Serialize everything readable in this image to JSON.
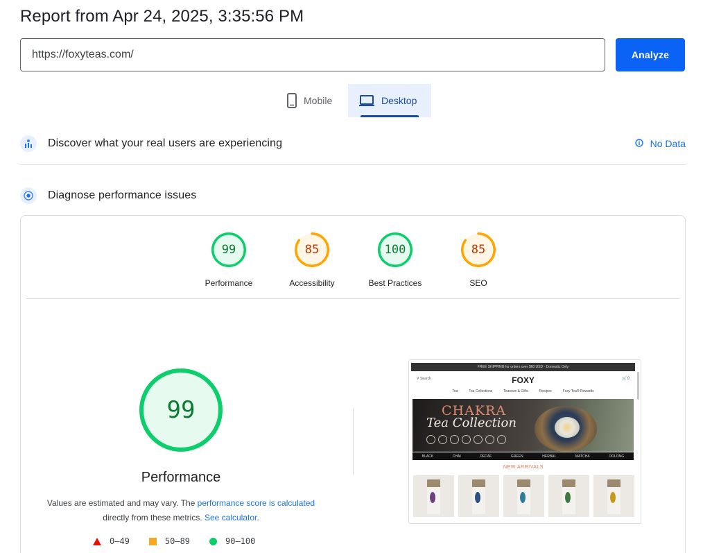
{
  "header": {
    "report_title": "Report from Apr 24, 2025, 3:35:56 PM"
  },
  "search": {
    "url_value": "https://foxyteas.com/",
    "analyze_label": "Analyze"
  },
  "tabs": [
    {
      "label": "Mobile",
      "icon": "smartphone-icon",
      "selected": false
    },
    {
      "label": "Desktop",
      "icon": "laptop-icon",
      "selected": true
    }
  ],
  "field_data": {
    "title": "Discover what your real users are experiencing",
    "status": "No Data",
    "icon": "users-chart-icon"
  },
  "lab_data": {
    "title": "Diagnose performance issues",
    "icon": "gauge-target-icon"
  },
  "scores": [
    {
      "label": "Performance",
      "value": 99,
      "color": "#0cce6b",
      "text_color": "#0a7c31"
    },
    {
      "label": "Accessibility",
      "value": 85,
      "color": "#ffa400",
      "text_color": "#c33300"
    },
    {
      "label": "Best Practices",
      "value": 100,
      "color": "#0cce6b",
      "text_color": "#0a7c31"
    },
    {
      "label": "SEO",
      "value": 85,
      "color": "#ffa400",
      "text_color": "#c33300"
    }
  ],
  "performance": {
    "score": "99",
    "score_value": 99,
    "label": "Performance",
    "note_text_1": "Values are estimated and may vary. The ",
    "note_link_1": "performance score is calculated",
    "note_text_2": "directly from these metrics. ",
    "note_link_2": "See calculator",
    "note_text_3": "."
  },
  "legend": [
    {
      "shape": "triangle",
      "range": "0–49",
      "color": "#eb0f00"
    },
    {
      "shape": "square",
      "range": "50–89",
      "color": "#f7a823"
    },
    {
      "shape": "circle",
      "range": "90–100",
      "color": "#0cce6b"
    }
  ],
  "site_screenshot": {
    "topbar": "FREE SHIPPING for orders over $60 USD · Domestic Only",
    "search": "Search",
    "logo": "FOXY",
    "cart": "0",
    "nav": [
      "Tea",
      "Tea Collections",
      "Teaware & Gifts",
      "Recipes",
      "Foxy Tea® Rewards"
    ],
    "banner_line1": "CHAKRA",
    "banner_line2": "Tea Collection",
    "categories": [
      "BLACK",
      "CHAI",
      "DECAF",
      "GREEN",
      "HERBAL",
      "MATCHA",
      "OOLONG"
    ],
    "new_arrivals": "NEW ARRIVALS",
    "product_leaf_colors": [
      "#6b3f7d",
      "#2d4f86",
      "#2e7d9b",
      "#3e7a40",
      "#c49a1e"
    ]
  }
}
